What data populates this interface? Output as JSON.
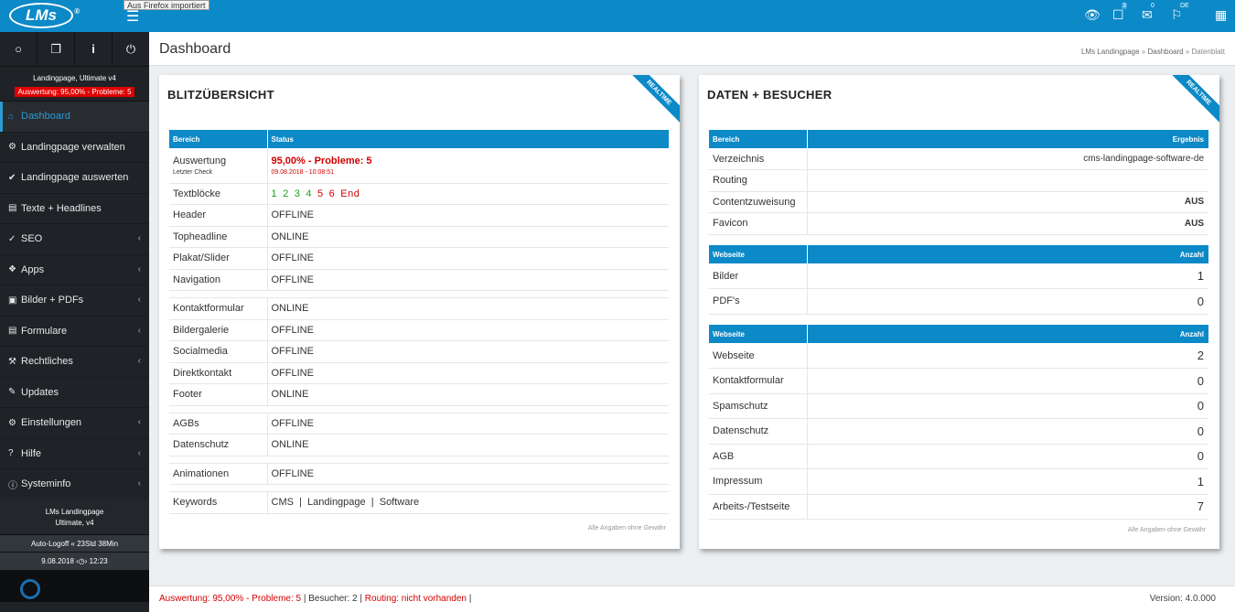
{
  "topbar": {
    "logo": "LMs",
    "logo_mark": "®",
    "tooltip": "Aus Firefox importiert",
    "icons": [
      "eye-icon",
      "tasks-icon",
      "envelope-icon",
      "flag-icon",
      "grid-icon"
    ],
    "badge_tasks": "3",
    "badge_mail": "0",
    "badge_flag": "DE"
  },
  "sidebar": {
    "top_icons": [
      "power-ring-icon",
      "copy-icon",
      "info-icon",
      "power-icon"
    ],
    "site_name": "Landingpage, Ultimate v4",
    "alert": "Auswertung: 95,00% - Probleme: 5",
    "menu": [
      {
        "label": "Dashboard",
        "icon": "home-icon",
        "active": true
      },
      {
        "label": "Landingpage verwalten",
        "icon": "gear-icon"
      },
      {
        "label": "Landingpage auswerten",
        "icon": "check-circle-icon"
      },
      {
        "label": "Texte + Headlines",
        "icon": "document-icon"
      },
      {
        "label": "SEO",
        "icon": "check-icon",
        "sub": true
      },
      {
        "label": "Apps",
        "icon": "cubes-icon",
        "sub": true
      },
      {
        "label": "Bilder + PDFs",
        "icon": "pictures-icon",
        "sub": true
      },
      {
        "label": "Formulare",
        "icon": "form-icon",
        "sub": true
      },
      {
        "label": "Rechtliches",
        "icon": "gavel-icon",
        "sub": true
      },
      {
        "label": "Updates",
        "icon": "wrench-icon"
      },
      {
        "label": "Einstellungen",
        "icon": "gears-icon",
        "sub": true
      },
      {
        "label": "Hilfe",
        "icon": "question-icon",
        "sub": true
      },
      {
        "label": "Systeminfo",
        "icon": "info-circle-icon",
        "sub": true
      }
    ],
    "product_line1": "LMs Landingpage",
    "product_line2": "Ultimate, v4",
    "autologoff": "Auto-Logoff « 23Std 38Min",
    "date": "9.08.2018",
    "time": "12:23"
  },
  "header": {
    "title": "Dashboard",
    "crumb1": "LMs Landingpage",
    "crumb2": "Dashboard",
    "crumb3": "Datenblatt",
    "sep": " » "
  },
  "left_panel": {
    "title": "BLITZÜBERSICHT",
    "ribbon": "REALTIME",
    "col1": "Bereich",
    "col2": "Status",
    "auswertung_label": "Auswertung",
    "letzter_check": "Letzter Check",
    "auswertung_value": "95,00% - Probleme: 5",
    "check_time": "09.08.2018 - 10:08:51",
    "textbloecke_label": "Textblöcke",
    "textbloecke": [
      {
        "t": "1",
        "c": "green"
      },
      {
        "t": "2",
        "c": "green"
      },
      {
        "t": "3",
        "c": "green"
      },
      {
        "t": "4",
        "c": "green"
      },
      {
        "t": "5",
        "c": "red"
      },
      {
        "t": "6",
        "c": "red"
      },
      {
        "t": "End",
        "c": "red"
      }
    ],
    "group1": [
      {
        "label": "Header",
        "status": "OFFLINE"
      },
      {
        "label": "Topheadline",
        "status": "ONLINE"
      },
      {
        "label": "Plakat/Slider",
        "status": "OFFLINE"
      },
      {
        "label": "Navigation",
        "status": "OFFLINE"
      }
    ],
    "group2": [
      {
        "label": "Kontaktformular",
        "status": "ONLINE"
      },
      {
        "label": "Bildergalerie",
        "status": "OFFLINE"
      },
      {
        "label": "Socialmedia",
        "status": "OFFLINE"
      },
      {
        "label": "Direktkontakt",
        "status": "OFFLINE"
      },
      {
        "label": "Footer",
        "status": "ONLINE"
      }
    ],
    "group3": [
      {
        "label": "AGBs",
        "status": "OFFLINE"
      },
      {
        "label": "Datenschutz",
        "status": "ONLINE"
      }
    ],
    "group4": [
      {
        "label": "Animationen",
        "status": "OFFLINE"
      }
    ],
    "keywords_label": "Keywords",
    "keywords": "CMS  |  Landingpage  |  Software",
    "note": "Alle Angaben ohne Gewähr"
  },
  "right_panel": {
    "title": "DATEN + BESUCHER",
    "ribbon": "REALTIME",
    "t1_col1": "Bereich",
    "t1_col2": "Ergebnis",
    "t1_rows": [
      {
        "label": "Verzeichnis",
        "value": "cms-landingpage-software-de",
        "cls": ""
      },
      {
        "label": "Routing",
        "value": "",
        "cls": ""
      },
      {
        "label": "Contentzuweisung",
        "value": "AUS",
        "cls": "red bold"
      },
      {
        "label": "Favicon",
        "value": "AUS",
        "cls": "red bold"
      }
    ],
    "t2_col1": "Webseite",
    "t2_col2": "Anzahl",
    "t2_rows": [
      {
        "label": "Bilder",
        "value": "1"
      },
      {
        "label": "PDF's",
        "value": "0"
      }
    ],
    "t3_col1": "Webseite",
    "t3_col2": "Anzahl",
    "t3_rows": [
      {
        "label": "Webseite",
        "value": "2"
      },
      {
        "label": "Kontaktformular",
        "value": "0"
      },
      {
        "label": "Spamschutz",
        "value": "0"
      },
      {
        "label": "Datenschutz",
        "value": "0"
      },
      {
        "label": "AGB",
        "value": "0"
      },
      {
        "label": "Impressum",
        "value": "1"
      },
      {
        "label": "Arbeits-/Testseite",
        "value": "7"
      }
    ],
    "note": "Alle Angaben ohne Gewähr"
  },
  "footer": {
    "auswertung": "Auswertung: 95,00% - Probleme: 5",
    "besucher": "Besucher: 2",
    "routing": "Routing: nicht vorhanden",
    "sep": " | ",
    "version": "Version: 4.0.000"
  }
}
